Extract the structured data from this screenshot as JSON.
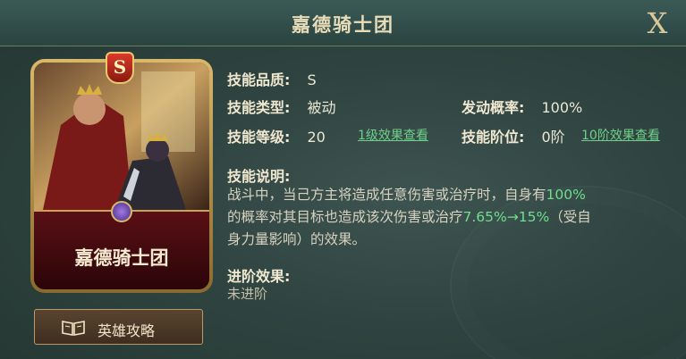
{
  "window": {
    "title": "嘉德骑士团",
    "close_label": "X"
  },
  "card": {
    "name": "嘉德骑士团",
    "grade": "S"
  },
  "guide_button": {
    "label": "英雄攻略"
  },
  "skill": {
    "quality_label": "技能品质:",
    "quality_value": "S",
    "type_label": "技能类型:",
    "type_value": "被动",
    "chance_label": "发动概率:",
    "chance_value": "100%",
    "level_label": "技能等级:",
    "level_value": "20",
    "level_link": "1级效果查看",
    "rank_label": "技能阶位:",
    "rank_value": "0阶",
    "rank_link": "10阶效果查看",
    "desc_label": "技能说明:",
    "desc_line1_a": "战斗中，当己方主将造成任意伤害或治疗时，自身有",
    "desc_line1_b": "100%",
    "desc_line2_a": "的概率对其目标也造成该次伤害或治疗",
    "desc_line2_b": "7.65%→15%",
    "desc_line2_c": "（受自",
    "desc_line3": "身力量影响）的效果。",
    "advance_label": "进阶效果:",
    "advance_value": "未进阶"
  },
  "colors": {
    "highlight": "#6fe08e",
    "link": "#6fd08a",
    "title": "#e8ddb8"
  }
}
